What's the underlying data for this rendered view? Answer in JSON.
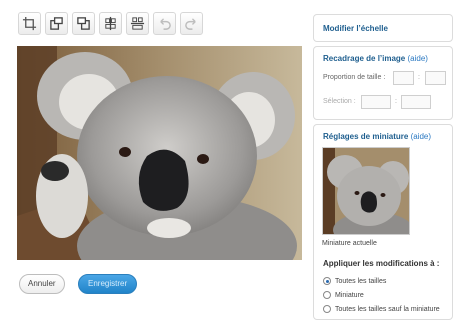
{
  "toolbar": {
    "icons": [
      "crop-icon",
      "rotate-left-icon",
      "rotate-right-icon",
      "flip-vertical-icon",
      "flip-horizontal-icon",
      "undo-icon",
      "redo-icon"
    ]
  },
  "actions": {
    "cancel_label": "Annuler",
    "save_label": "Enregistrer"
  },
  "scale_panel": {
    "title": "Modifier l’échelle"
  },
  "crop_panel": {
    "title": "Recadrage de l’image",
    "help": "(aide)",
    "ratio_label": "Proportion de taille :",
    "ratio_sep": ":",
    "selection_label": "Sélection :",
    "selection_sep": ":"
  },
  "thumb_panel": {
    "title": "Réglages de miniature",
    "help": "(aide)",
    "current_caption": "Miniature actuelle",
    "apply_heading": "Appliquer les modifications à :",
    "options": [
      {
        "label": "Toutes les tailles",
        "checked": true
      },
      {
        "label": "Miniature",
        "checked": false
      },
      {
        "label": "Toutes les tailles sauf la miniature",
        "checked": false
      }
    ]
  },
  "colors": {
    "accent": "#2184c9",
    "panel_title": "#1f5f8f"
  }
}
